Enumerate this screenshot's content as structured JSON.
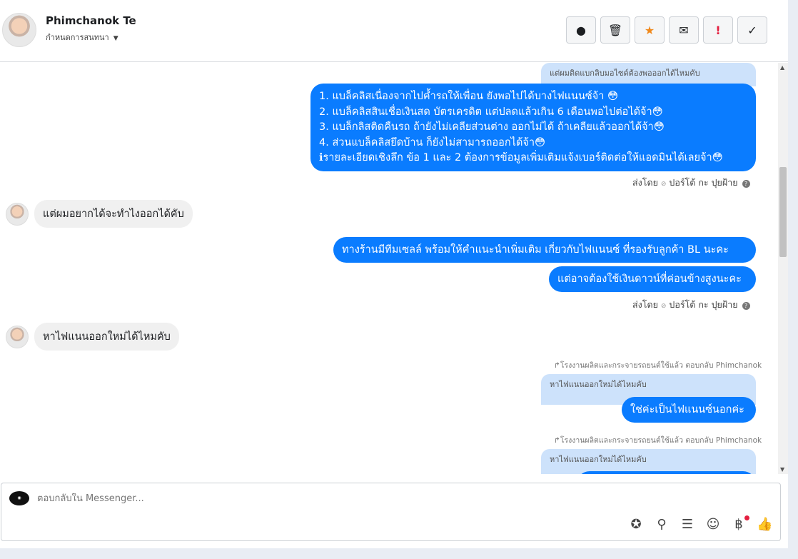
{
  "contact": {
    "name": "Phimchanok Te",
    "assign_label": "กำหนดการสนทนา"
  },
  "header_actions": [
    {
      "icon": "alert-circle-icon",
      "glyph": "●"
    },
    {
      "icon": "trash-icon",
      "glyph": "🗑"
    },
    {
      "icon": "star-icon",
      "glyph": "★"
    },
    {
      "icon": "envelope-icon",
      "glyph": "✉"
    },
    {
      "icon": "exclamation-icon",
      "glyph": "!"
    },
    {
      "icon": "check-icon",
      "glyph": "✓"
    }
  ],
  "thread": {
    "quote_top": "แต่ผมติดแบกลิบมอไซด์ต้องพอออกได้ไหมคับ",
    "msg1_lines": [
      "1. แบล็คลิสเนื่องจากไปค้ำรถให้เพื่อน ยังพอไปได้บางไฟแนนซ์จ้า 😳",
      "2. แบล็คลิสสินเชื่อเงินสด บัตรเครดิต แต่ปลดแล้วเกิน 6 เดือนพอไปต่อได้จ้า😳",
      "3. แบล็กลิสติดคืนรถ ถ้ายังไม่เคลียส่วนต่าง ออกไม่ได้ ถ้าเคลียแล้วออกได้จ้า😳",
      "4. ส่วนแบล็คลิสยึดบ้าน ก็ยังไม่สามารถออกได้จ้า😳",
      "ℹรายละเอียดเชิงลึก ข้อ 1 และ 2 ต้องการข้อมูลเพิ่มเติมแจ้งเบอร์ติดต่อให้แอดมินได้เลยจ้า😳"
    ],
    "sent_by_1": "ส่งโดย",
    "sender_1": "ปอร์โต้ กะ ปุยฝ้าย",
    "in1": "แต่ผมอยากได้จะทำไงออกได้คับ",
    "out2a": "ทางร้านมีทีมเซลล์ พร้อมให้คำแนะนำเพิ่มเติม เกี่ยวกับไฟแนนซ์ ที่รองรับลูกค้า BL นะคะ",
    "out2b": "แต่อาจต้องใช้เงินดาวน์ที่ค่อนข้างสูงนะคะ",
    "sent_by_2": "ส่งโดย",
    "sender_2": "ปอร์โต้ กะ ปุยฝ้าย",
    "in2": "หาไฟแนนออกใหม่ได้ไหมคับ",
    "reply_note_1": "โรงงานผลิตและกระจายรถยนต์ใช้แล้ว ตอบกลับ Phimchanok",
    "quote_2": "หาไฟแนนออกใหม่ได้ไหมคับ",
    "out3": "ใช่ค่ะเป็นไฟแนนซ์นอกค่ะ",
    "reply_note_2": "โรงงานผลิตและกระจายรถยนต์ใช้แล้ว ตอบกลับ Phimchanok",
    "quote_3": "หาไฟแนนออกใหม่ได้ไหมคับ"
  },
  "composer": {
    "placeholder": "ตอบกลับใน Messenger...",
    "tools": [
      "sticker-icon",
      "paperclip-icon",
      "quick-reply-icon",
      "emoji-icon",
      "baht-icon",
      "thumbs-up-icon"
    ]
  },
  "colors": {
    "outgoing": "#0a7cff",
    "quote": "#cde2fb",
    "incoming": "#f0f0f0"
  }
}
